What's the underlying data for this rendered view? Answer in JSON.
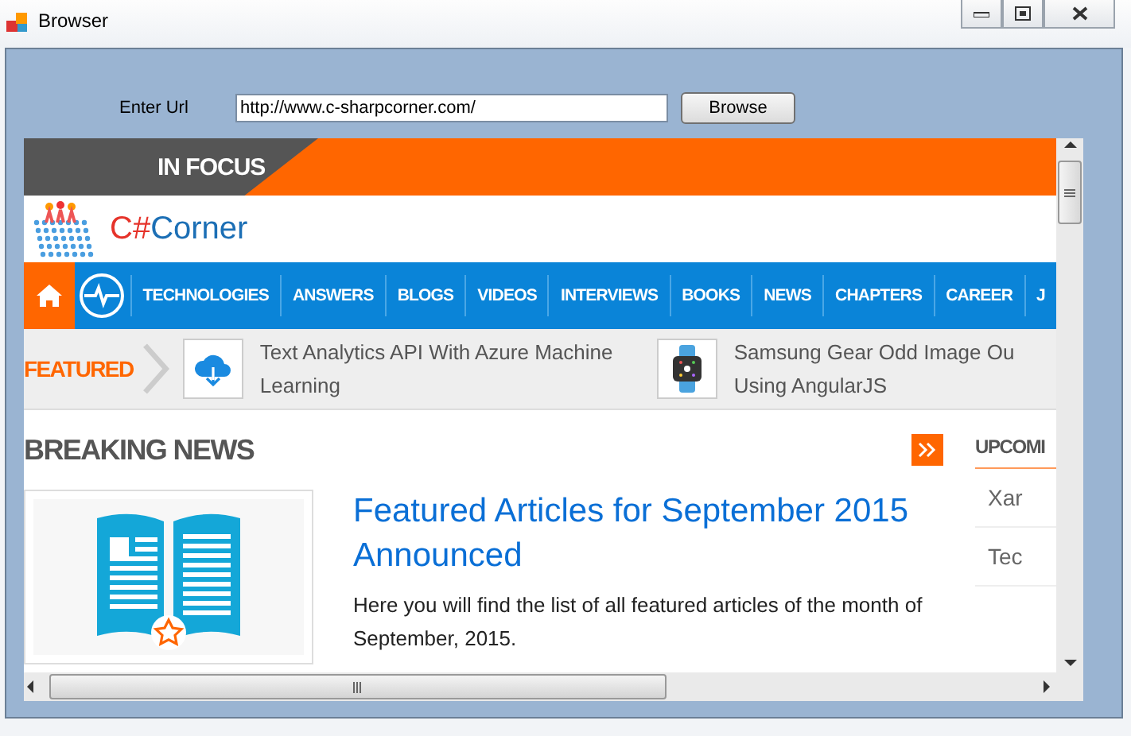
{
  "window": {
    "title": "Browser"
  },
  "url_bar": {
    "label": "Enter Url",
    "value": "http://www.c-sharpcorner.com/",
    "button": "Browse"
  },
  "page": {
    "focus_banner": "IN FOCUS",
    "logo": {
      "mark": "C#",
      "name": "Corner"
    },
    "nav": {
      "home_selected": true,
      "items": [
        "TECHNOLOGIES",
        "ANSWERS",
        "BLOGS",
        "VIDEOS",
        "INTERVIEWS",
        "BOOKS",
        "NEWS",
        "CHAPTERS",
        "CAREER",
        "J"
      ]
    },
    "featured": {
      "label": "FEATURED",
      "items": [
        {
          "kind": "cloud",
          "title": "Text Analytics API With Azure Machine Learning"
        },
        {
          "kind": "watch",
          "title": "Samsung Gear Odd Image Ou Using AngularJS"
        }
      ]
    },
    "breaking_news": {
      "heading": "BREAKING NEWS",
      "article_title": "Featured Articles for September 2015 Announced",
      "summary": "Here you will find the list of all featured articles of the month of September, 2015."
    },
    "sidebar": {
      "heading": "UPCOMI",
      "items": [
        "Xar",
        "Tec"
      ]
    }
  }
}
